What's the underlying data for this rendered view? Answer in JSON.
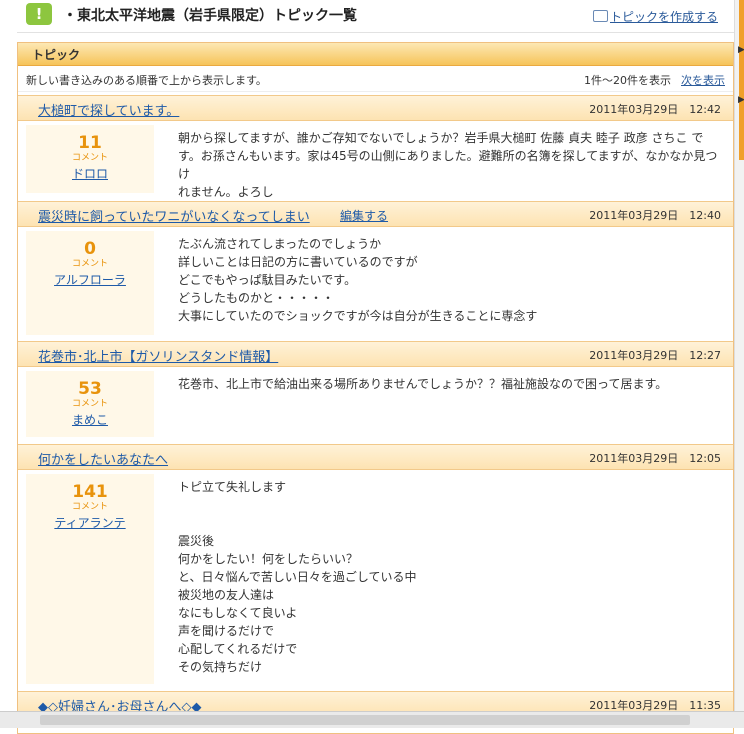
{
  "header": {
    "title": "・東北太平洋地震（岩手県限定）トピック一覧",
    "create_link": "トピックを作成する"
  },
  "panel": {
    "tab_label": "トピック",
    "description": "新しい書き込みのある順番で上から表示します。",
    "range": "1件～20件を表示",
    "next_label": "次を表示"
  },
  "topics": [
    {
      "title": "大槌町で探しています。",
      "datetime": "2011年03月29日　12:42",
      "count": "11",
      "count_label": "コメント",
      "user": "ドロロ",
      "body": "朝から探してますが、誰かご存知でないでしょうか？岩手県大槌町 佐藤 貞夫 睦子 政彦 さちこ で\nす。お孫さんもいます。家は45号の山側にありました。避難所の名簿を探してますが、なかなか見つけ\nれません。よろし"
    },
    {
      "title": "震災時に飼っていたワニがいなくなってしまい",
      "edit_label": "編集する",
      "datetime": "2011年03月29日　12:40",
      "count": "0",
      "count_label": "コメント",
      "user": "アルフローラ",
      "body": "たぶん流されてしまったのでしょうか\n詳しいことは日記の方に書いているのですが\nどこでもやっぱ駄目みたいです。\nどうしたものかと・・・・・\n大事にしていたのでショックですが今は自分が生きることに専念す"
    },
    {
      "title": "花巻市･北上市【ガソリンスタンド情報】",
      "datetime": "2011年03月29日　12:27",
      "count": "53",
      "count_label": "コメント",
      "user": "まめこ",
      "body": "花巻市、北上市で給油出来る場所ありませんでしょうか？？福祉施設なので困って居ます。"
    },
    {
      "title": "何かをしたいあなたへ",
      "datetime": "2011年03月29日　12:05",
      "count": "141",
      "count_label": "コメント",
      "user": "ティアランテ",
      "body": "トピ立て失礼します\n\n\n震災後\n何かをしたい！何をしたらいい？\nと、日々悩んで苦しい日々を過ごしている中\n被災地の友人達は\nなにもしなくて良いよ\n声を聞けるだけで\n心配してくれるだけで\nその気持ちだけ"
    },
    {
      "title": "◆◇妊婦さん･お母さんへ◇◆",
      "datetime": "2011年03月29日　11:35"
    }
  ],
  "colors": {
    "accent_orange": "#f0a02a",
    "link_blue": "#1e5aa8",
    "count_orange": "#e8930c"
  }
}
